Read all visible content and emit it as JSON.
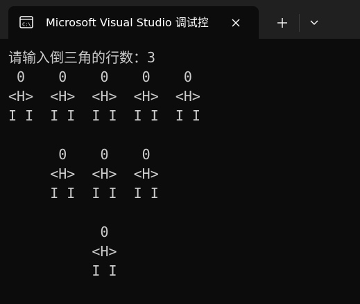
{
  "window": {
    "tab_title": "Microsoft Visual Studio 调试控",
    "tab_icon": "console-app-icon",
    "close_icon": "close-icon",
    "new_tab_icon": "plus-icon",
    "dropdown_icon": "chevron-down-icon",
    "colors": {
      "titlebar": "#202020",
      "tab": "#0c0c0c",
      "text": "#cccccc"
    }
  },
  "console": {
    "lines": [
      "请输入倒三角的行数：3",
      " 0    0    0    0    0",
      "<H>  <H>  <H>  <H>  <H>",
      "I I  I I  I I  I I  I I",
      "",
      "      0    0    0",
      "     <H>  <H>  <H>",
      "     I I  I I  I I",
      "",
      "           0",
      "          <H>",
      "          I I"
    ]
  }
}
